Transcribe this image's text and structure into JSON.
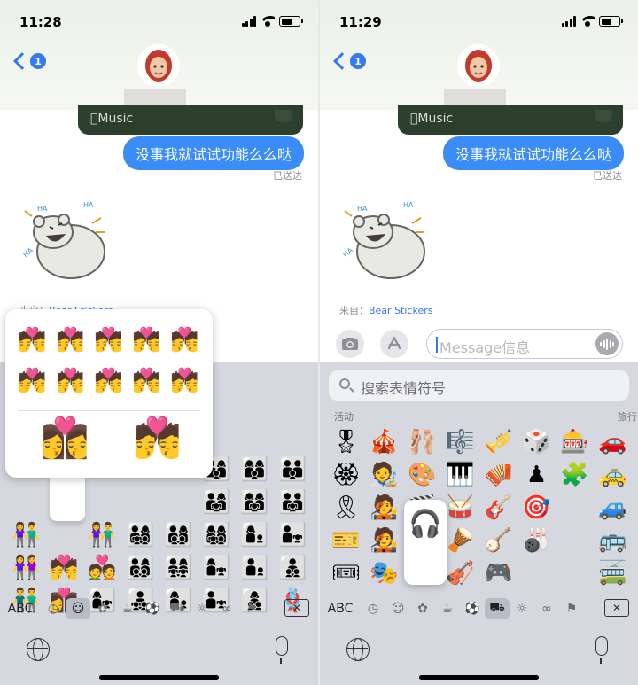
{
  "colors": {
    "accent": "#3478f6",
    "bubble": "#3a8cf7",
    "keyboard": "#d5d8df"
  },
  "left": {
    "status": {
      "time": "11:28"
    },
    "back_badge": "1",
    "music_label": "Music",
    "bubble_text": "没事我就试试功能么么哒",
    "delivered": "已送达",
    "sticker_from_prefix": "来自：",
    "sticker_from_name": "Bear Stickers",
    "keyboard": {
      "abc_label": "ABC",
      "selected_tab": "smileys-people",
      "grid": [
        "",
        "",
        "",
        "",
        "",
        "",
        "",
        "",
        "",
        "",
        "",
        "",
        "",
        "👨‍👩‍👦",
        "👩‍👩‍👦",
        "👨‍👨‍👦",
        "",
        "",
        "",
        "",
        "",
        "👨‍👩‍👧",
        "👩‍👩‍👧",
        "👨‍👨‍👧",
        "👫",
        "",
        "👫",
        "👨‍👩‍👧‍👦",
        "👨‍👩‍👦‍👦",
        "👩‍👩‍👧‍👦",
        "👩‍👦",
        "👨‍👧",
        "👭",
        "💏",
        "💑",
        "👨‍👩‍👦‍👦",
        "👨‍👩‍👧‍👧",
        "👩‍👧",
        "👨‍👦",
        "👨‍👦‍👦",
        "👬",
        "👩‍❤️‍💋‍👩",
        "👩‍👧",
        "👨‍👧‍👦",
        "👩‍👦",
        "👨‍👧",
        "👩‍👦‍👦",
        "🪢"
      ],
      "popover_row1": [
        "💏",
        "💏",
        "💏",
        "💏",
        "💏"
      ],
      "popover_row2": [
        "💏",
        "💏",
        "💏",
        "💏",
        "💏"
      ],
      "popover_big": [
        "👩‍❤️‍💋‍👩",
        "💏"
      ]
    }
  },
  "right": {
    "status": {
      "time": "11:29"
    },
    "back_badge": "1",
    "music_label": "Music",
    "bubble_text": "没事我就试试功能么么哒",
    "delivered": "已送达",
    "sticker_from_prefix": "来自：",
    "sticker_from_name": "Bear Stickers",
    "input_placeholder": "Message信息",
    "keyboard": {
      "search_placeholder": "搜索表情符号",
      "category_left": "活动",
      "category_right": "旅行",
      "abc_label": "ABC",
      "selected_tab": "objects",
      "grid": [
        "🎖",
        "🎪",
        "🩰",
        "🎼",
        "🎺",
        "🎲",
        "🎰",
        "🚗",
        "🏵",
        "🧑‍🎨",
        "🎨",
        "🎹",
        "🪗",
        "♟",
        "🧩",
        "🚕",
        "🎗",
        "🧑‍🎤",
        "🎬",
        "🥁",
        "🎸",
        "🎯",
        "",
        "🚙",
        "🎫",
        "🧑‍🎤",
        "🎧",
        "🪘",
        "🪕",
        "🎳",
        "",
        "🚌",
        "🎟",
        "🎭",
        "🎷",
        "🎻",
        "🎮",
        "",
        "",
        "🚎"
      ],
      "preview": "🎧"
    }
  }
}
